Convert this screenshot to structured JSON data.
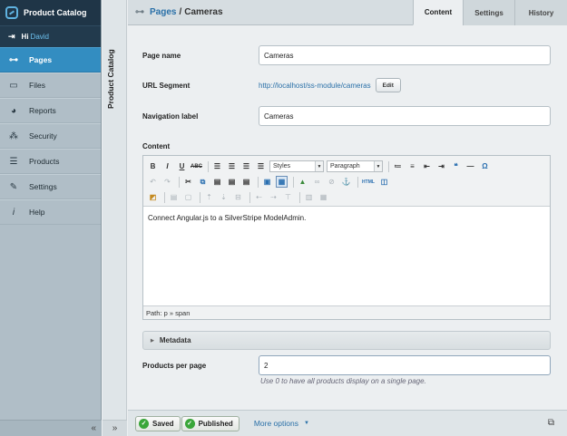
{
  "app": {
    "title": "Product Catalog",
    "greeting": "Hi",
    "user": "David"
  },
  "menu": {
    "items": [
      {
        "label": "Pages",
        "icon": "sitemap-icon",
        "active": true
      },
      {
        "label": "Files",
        "icon": "image-icon"
      },
      {
        "label": "Reports",
        "icon": "pie-chart-icon"
      },
      {
        "label": "Security",
        "icon": "users-icon"
      },
      {
        "label": "Products",
        "icon": "database-icon"
      },
      {
        "label": "Settings",
        "icon": "wrench-icon"
      },
      {
        "label": "Help",
        "icon": "info-icon"
      }
    ],
    "collapse_glyph": "«"
  },
  "tree": {
    "title": "Product Catalog",
    "collapse_glyph": "»"
  },
  "header": {
    "breadcrumb_parent": "Pages",
    "breadcrumb_separator": "/",
    "breadcrumb_current": "Cameras"
  },
  "tabs": [
    {
      "label": "Content",
      "active": true
    },
    {
      "label": "Settings"
    },
    {
      "label": "History"
    }
  ],
  "form": {
    "page_name_label": "Page name",
    "page_name_value": "Cameras",
    "url_segment_label": "URL Segment",
    "url_segment_value": "http://localhost/ss-module/cameras",
    "edit_label": "Edit",
    "nav_label_label": "Navigation label",
    "nav_label_value": "Cameras",
    "content_label": "Content",
    "editor": {
      "styles_select": "Styles",
      "format_select": "Paragraph",
      "body_text": "Connect Angular.js to a SilverStripe ModelAdmin.",
      "path": "Path: p » span"
    },
    "metadata_label": "Metadata",
    "products_per_page_label": "Products per page",
    "products_per_page_value": "2",
    "products_per_page_help": "Use 0 to have all products display on a single page."
  },
  "footer": {
    "saved_label": "Saved",
    "published_label": "Published",
    "more_options_label": "More options"
  }
}
